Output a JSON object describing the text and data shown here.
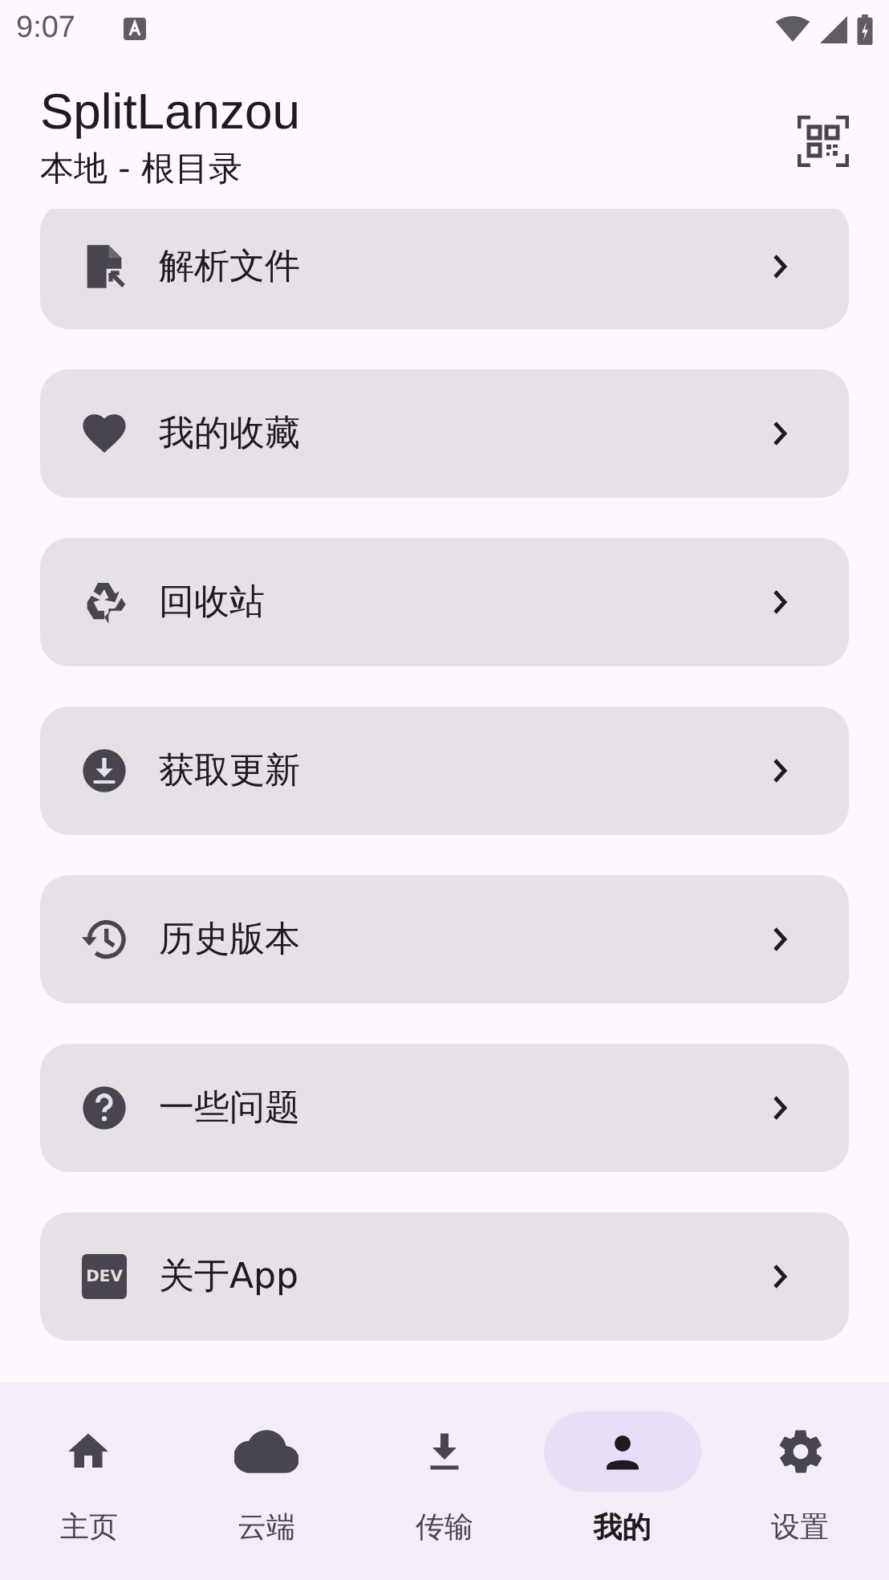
{
  "status_bar": {
    "time": "9:07"
  },
  "header": {
    "title": "SplitLanzou",
    "subtitle": "本地 - 根目录"
  },
  "menu_items": [
    {
      "label": "解析文件",
      "kind": "file"
    },
    {
      "label": "我的收藏",
      "kind": "heart"
    },
    {
      "label": "回收站",
      "kind": "recycle"
    },
    {
      "label": "获取更新",
      "kind": "download"
    },
    {
      "label": "历史版本",
      "kind": "history"
    },
    {
      "label": "一些问题",
      "kind": "help"
    },
    {
      "label": "关于App",
      "kind": "dev",
      "badge": "DEV"
    }
  ],
  "bottom_nav": [
    {
      "label": "主页",
      "kind": "home",
      "selected": false
    },
    {
      "label": "云端",
      "kind": "cloud",
      "selected": false
    },
    {
      "label": "传输",
      "kind": "download",
      "selected": false
    },
    {
      "label": "我的",
      "kind": "person",
      "selected": true
    },
    {
      "label": "设置",
      "kind": "settings",
      "selected": false
    }
  ]
}
